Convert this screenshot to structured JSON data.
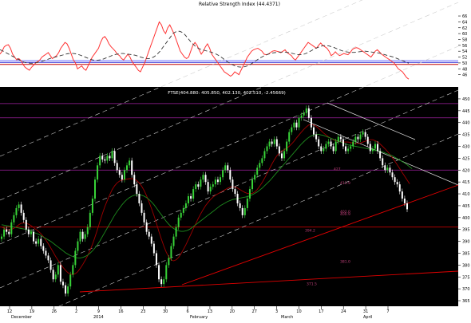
{
  "colors": {
    "rsi_line": "#ff3333",
    "rsi_avg": "#333333",
    "rsi_levels": [
      "#c00000",
      "#0000cc",
      "#6a6aff"
    ],
    "price_bg": "#000000",
    "candle_up": "#38d338",
    "candle_down": "#ffffff",
    "ma_short": "#a00000",
    "ma_long": "#1e8c1e",
    "trend_red": "#e00000",
    "channel_white": "#cccccc",
    "hline_magenta": "#a020a0",
    "annot_text": "#c0407a"
  },
  "chart_data": [
    {
      "type": "line",
      "title": "Relative Strength Index (44.4371)",
      "y_ticks": [
        46,
        48,
        50,
        52,
        54,
        56,
        58,
        60,
        62,
        64,
        66
      ],
      "ylim": [
        44,
        69
      ],
      "reference_levels": [
        49.5,
        50.2,
        50.8
      ],
      "grid": false,
      "series": [
        {
          "role": "rsi",
          "values": [
            53,
            54,
            55.5,
            56,
            56.2,
            55,
            53,
            52,
            51,
            51.5,
            50.8,
            49.5,
            48.5,
            48,
            47.5,
            48.5,
            49.2,
            50,
            50.5,
            51,
            52,
            52.5,
            53,
            53.5,
            52.5,
            51.5,
            52,
            52.5,
            53.5,
            55,
            56,
            57,
            56.5,
            55,
            53,
            51,
            50,
            48,
            48.5,
            49,
            48,
            47.5,
            49,
            50.5,
            52,
            53,
            54,
            55,
            57,
            58.5,
            59,
            58,
            56.5,
            55.5,
            54.8,
            54,
            53,
            52.5,
            51.5,
            51,
            52,
            53,
            52,
            50.5,
            49.5,
            48.5,
            47.5,
            47,
            48.5,
            50,
            52,
            54,
            56,
            58,
            60,
            62,
            64,
            63,
            61,
            60,
            62,
            63,
            61.5,
            60,
            58,
            56,
            54,
            53,
            52,
            51.5,
            52,
            54,
            56,
            57,
            56,
            54.5,
            53,
            54,
            55.5,
            56.5,
            55,
            53,
            52,
            51,
            50,
            49,
            48,
            47,
            46.5,
            46,
            45.5,
            46,
            47,
            46.5,
            46,
            47.5,
            49,
            50.5,
            52,
            53,
            54,
            54.5,
            54.8,
            55,
            54.5,
            54,
            53,
            52.8,
            53,
            53.5,
            54,
            54.2,
            54,
            53.8,
            53.5,
            54,
            54.5,
            53.5,
            53,
            52.5,
            51.5,
            51,
            52,
            53,
            54,
            55,
            56,
            57,
            56.5,
            56,
            55.5,
            55,
            56,
            56.8,
            56,
            55.5,
            55,
            54,
            52.5,
            53,
            53.8,
            53,
            52.5,
            52.8,
            53.2,
            53,
            52.8,
            53.5,
            54.5,
            55,
            55.2,
            55,
            54.5,
            54,
            53.5,
            53,
            52.5,
            52,
            53,
            54,
            54.5,
            53.8,
            53,
            52.5,
            52,
            51.5,
            51,
            50.5,
            50,
            49,
            48,
            47.5,
            47,
            46,
            45,
            44.5
          ]
        },
        {
          "role": "average",
          "values": [
            54.5,
            54.2,
            53.8,
            53.4,
            53,
            52.6,
            52.2,
            51.8,
            51.4,
            51,
            50.6,
            50.3,
            50.1,
            50,
            49.9,
            49.9,
            50,
            50.1,
            50.3,
            50.5,
            50.7,
            51,
            51.2,
            51.5,
            51.7,
            51.9,
            52.1,
            52.3,
            52.5,
            52.7,
            52.9,
            53.1,
            53.2,
            53.3,
            53.2,
            53.1,
            52.9,
            52.7,
            52.4,
            52.1,
            51.8,
            51.5,
            51.2,
            51,
            50.9,
            50.9,
            51,
            51.2,
            51.4,
            51.7,
            52,
            52.3,
            52.6,
            52.8,
            53,
            53.1,
            53.2,
            53.2,
            53.1,
            53,
            52.9,
            52.8,
            52.7,
            52.5,
            52.3,
            52,
            51.8,
            51.6,
            51.5,
            51.5,
            51.7,
            52,
            52.5,
            53.2,
            54,
            55,
            56,
            57,
            58,
            59,
            60,
            60.5,
            60.8,
            60.8,
            60.5,
            60,
            59.2,
            58.3,
            57.4,
            56.6,
            55.9,
            55.3,
            54.9,
            54.6,
            54.4,
            54.2,
            54,
            53.8,
            53.6,
            53.3,
            53,
            52.6,
            52.1,
            51.6,
            51,
            50.5,
            50,
            49.6,
            49.2,
            48.9,
            48.7,
            48.6,
            48.6,
            48.7,
            48.9,
            49.2,
            49.6,
            50.1,
            50.6,
            51.1,
            51.6,
            52,
            52.4,
            52.7,
            53,
            53.2,
            53.4,
            53.5,
            53.6,
            53.7,
            53.7,
            53.7,
            53.7,
            53.6,
            53.5,
            53.3,
            53.1,
            52.9,
            52.8,
            52.8,
            52.9,
            53.1,
            53.4,
            53.8,
            54.2,
            54.6,
            55,
            55.3,
            55.6,
            55.8,
            55.9,
            55.9,
            55.8,
            55.6,
            55.4,
            55.1,
            54.8,
            54.5,
            54.2,
            54,
            53.8,
            53.7,
            53.6,
            53.6,
            53.6,
            53.7,
            53.8,
            53.9,
            54,
            54,
            53.9,
            53.8,
            53.7,
            53.6,
            53.5,
            53.4,
            53.2,
            53,
            52.8,
            52.6,
            52.4,
            52.2,
            52,
            51.7,
            51.4,
            51.1,
            50.8,
            50.5,
            50.2,
            49.9
          ]
        }
      ]
    },
    {
      "type": "line",
      "title": "FTSE(404.880: 405.850, 402.130, 402.510, -2.45669)",
      "y_ticks": [
        365,
        370,
        375,
        380,
        385,
        390,
        395,
        400,
        405,
        410,
        415,
        420,
        425,
        430,
        435,
        440,
        445,
        450
      ],
      "ylim": [
        364,
        452
      ],
      "x_ticks": [
        "12",
        "19",
        "26",
        "2",
        "9",
        "16",
        "23",
        "30",
        "6",
        "13",
        "20",
        "27",
        "3",
        "10",
        "17",
        "24",
        "31",
        "7"
      ],
      "month_labels": [
        "December",
        "2014",
        "February",
        "March",
        "April"
      ],
      "annotations": [
        "427",
        "413.9",
        "400.9",
        "394.2",
        "371.5",
        "381.0",
        "402.0"
      ],
      "horizontal_levels": [
        448,
        442,
        420,
        396
      ],
      "grid": false,
      "series": [
        {
          "role": "close",
          "values": [
            392,
            395,
            394,
            393,
            398,
            401,
            404,
            405.5,
            402,
            399,
            395,
            393,
            394,
            390,
            389,
            391,
            388,
            386,
            384,
            382,
            378,
            374,
            376,
            380,
            373,
            371.5,
            368,
            371,
            376,
            380,
            386,
            390,
            394,
            391,
            393,
            396,
            402,
            408,
            416,
            422,
            426,
            424.5,
            424,
            426,
            425,
            428,
            423,
            420,
            418,
            416,
            420,
            422,
            424,
            418,
            414,
            410,
            406,
            402,
            398,
            394,
            392,
            389,
            385,
            380,
            374,
            372,
            374,
            380,
            383,
            388,
            392,
            396,
            400,
            402,
            404,
            406,
            409,
            408,
            412,
            414,
            413,
            416,
            418,
            415,
            411,
            413,
            414,
            416,
            415,
            417,
            420,
            422,
            420,
            416,
            412,
            410,
            406,
            404,
            401,
            404,
            408,
            412,
            416,
            418,
            421,
            423,
            425,
            428,
            430,
            432,
            431,
            433,
            430,
            427,
            425,
            428,
            432,
            436,
            438,
            440,
            438,
            442,
            443,
            444,
            446,
            442,
            438,
            435,
            433,
            430,
            428,
            429,
            431,
            432,
            430,
            428,
            432,
            434,
            433,
            430,
            428,
            429,
            430,
            432,
            434,
            433,
            435,
            436,
            434,
            431,
            428,
            429,
            431,
            428,
            425,
            422,
            420,
            421,
            419,
            417,
            415,
            414,
            411,
            408,
            406,
            403.5
          ]
        },
        {
          "role": "ma_short",
          "values": [
            396,
            395.5,
            395,
            394.8,
            395,
            395.5,
            396.2,
            397,
            397.6,
            397.8,
            397.6,
            397.2,
            396.6,
            395.8,
            395,
            394.2,
            393.2,
            392,
            390.6,
            389,
            387.2,
            385.4,
            383.6,
            382,
            380.4,
            379,
            377.8,
            376.8,
            376.2,
            376,
            376.4,
            377.2,
            378.6,
            380.2,
            382,
            384,
            386.2,
            388.8,
            391.8,
            395,
            398.4,
            401.6,
            404.6,
            407.2,
            409.6,
            411.8,
            413.4,
            414.6,
            415.4,
            415.8,
            416,
            416.2,
            416.4,
            416.4,
            416.2,
            415.6,
            414.6,
            413.2,
            411.4,
            409.2,
            406.6,
            403.8,
            400.8,
            397.6,
            394.2,
            391,
            388,
            385.4,
            383.4,
            382.2,
            381.8,
            382.2,
            383.2,
            384.8,
            386.6,
            388.6,
            390.8,
            393,
            395.2,
            397.4,
            399.6,
            401.6,
            403.4,
            405,
            406.4,
            407.6,
            408.6,
            409.4,
            410,
            410.6,
            411.2,
            411.8,
            412.4,
            412.8,
            413,
            412.8,
            412.4,
            411.8,
            411.2,
            410.6,
            410.2,
            410,
            410.2,
            410.8,
            411.8,
            413.2,
            414.8,
            416.6,
            418.6,
            420.6,
            422.6,
            424.4,
            426,
            427.2,
            428,
            428.6,
            429.2,
            430,
            431,
            432.2,
            433.6,
            434.8,
            436,
            437.2,
            438.2,
            439,
            439.2,
            439,
            438.4,
            437.6,
            436.6,
            435.6,
            434.8,
            434,
            433.4,
            432.8,
            432.4,
            432,
            431.8,
            431.8,
            431.8,
            431.8,
            431.6,
            431.4,
            431.2,
            431.2,
            431.4,
            431.8,
            432.2,
            432.6,
            432.8,
            432.8,
            432.4,
            431.8,
            431,
            430,
            429,
            427.8,
            426.6,
            425.2,
            423.8,
            422.2,
            420.6,
            419,
            417.4,
            415.8,
            414.2
          ]
        },
        {
          "role": "ma_long",
          "values": [
            397,
            396.8,
            396.6,
            396.4,
            396.2,
            396,
            395.8,
            395.6,
            395.4,
            395.2,
            395,
            394.6,
            394.2,
            393.8,
            393.4,
            393,
            392.4,
            391.8,
            391.2,
            390.6,
            390,
            389.2,
            388.4,
            387.6,
            386.8,
            386,
            385.2,
            384.6,
            384,
            383.6,
            383.2,
            383,
            383,
            383.2,
            383.6,
            384.2,
            385,
            386,
            387.2,
            388.6,
            390.2,
            392,
            393.8,
            395.6,
            397.4,
            399.2,
            401,
            402.6,
            404,
            405.4,
            406.6,
            407.6,
            408.4,
            409,
            409.4,
            409.6,
            409.6,
            409.4,
            409,
            408.4,
            407.6,
            406.6,
            405.4,
            404,
            402.6,
            401.2,
            399.8,
            398.4,
            397.2,
            396.2,
            395.4,
            394.8,
            394.4,
            394.2,
            394.2,
            394.4,
            394.8,
            395.4,
            396.2,
            397,
            397.8,
            398.6,
            399.4,
            400.2,
            401,
            401.8,
            402.6,
            403.4,
            404.2,
            405,
            405.6,
            406.2,
            406.8,
            407.2,
            407.6,
            407.8,
            408,
            408.2,
            408.4,
            408.6,
            408.8,
            409.2,
            409.6,
            410.2,
            410.8,
            411.6,
            412.4,
            413.4,
            414.4,
            415.4,
            416.6,
            417.8,
            419,
            420.2,
            421.4,
            422.6,
            423.8,
            425,
            426.2,
            427.4,
            428.6,
            429.8,
            431,
            432,
            433,
            433.8,
            434.4,
            434.8,
            435,
            435,
            434.8,
            434.6,
            434.2,
            433.8,
            433.4,
            433,
            432.6,
            432.2,
            431.8,
            431.4,
            431,
            430.6,
            430.4,
            430.2,
            430,
            429.8,
            429.6,
            429.4,
            429.2,
            429,
            428.8,
            428.6,
            428.4,
            428.2,
            428,
            427.6,
            427.2,
            426.8,
            426.4,
            426,
            425.4,
            424.8,
            424.2,
            423.6,
            423,
            422.2,
            421.4,
            420.6
          ]
        }
      ]
    }
  ]
}
